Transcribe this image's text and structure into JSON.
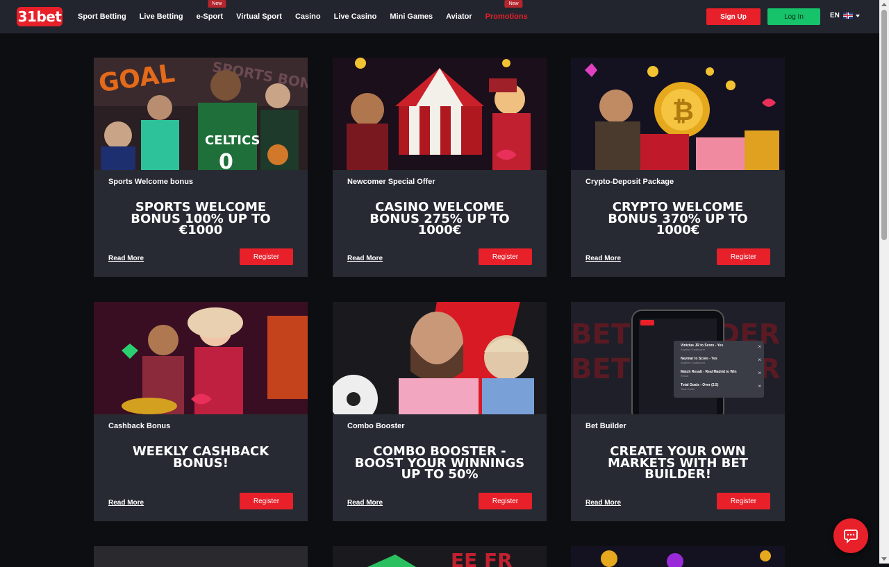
{
  "header": {
    "logo": "31bet",
    "nav": [
      {
        "label": "Sport Betting",
        "badge": ""
      },
      {
        "label": "Live Betting",
        "badge": ""
      },
      {
        "label": "e-Sport",
        "badge": "New"
      },
      {
        "label": "Virtual Sport",
        "badge": ""
      },
      {
        "label": "Casino",
        "badge": ""
      },
      {
        "label": "Live Casino",
        "badge": ""
      },
      {
        "label": "Mini Games",
        "badge": ""
      },
      {
        "label": "Aviator",
        "badge": ""
      },
      {
        "label": "Promotions",
        "badge": "New"
      }
    ],
    "signup_label": "Sign Up",
    "login_label": "Log In",
    "language": "EN"
  },
  "colors": {
    "accent_red": "#e8202a",
    "login_green": "#16c26a",
    "header_bg": "#22252d",
    "card_bg": "#272a33",
    "page_bg": "#0d0e12"
  },
  "promotions": [
    {
      "subtitle": "Sports Welcome bonus",
      "title": "SPORTS WELCOME BONUS 100% UP TO €1000",
      "read_more": "Read More",
      "register": "Register",
      "image": "sports-stars-image"
    },
    {
      "subtitle": "Newcomer Special Offer",
      "title": "CASINO WELCOME BONUS 275% UP TO 1000€",
      "read_more": "Read More",
      "register": "Register",
      "image": "casino-circus-image"
    },
    {
      "subtitle": "Crypto-Deposit Package",
      "title": "CRYPTO WELCOME BONUS 370% UP TO 1000€",
      "read_more": "Read More",
      "register": "Register",
      "image": "crypto-viking-bitcoin-image"
    },
    {
      "subtitle": "Cashback Bonus",
      "title": "WEEKLY CASHBACK BONUS!",
      "read_more": "Read More",
      "register": "Register",
      "image": "genie-characters-image"
    },
    {
      "subtitle": "Combo Booster",
      "title": "COMBO BOOSTER - BOOST YOUR WINNINGS UP TO 50%",
      "read_more": "Read More",
      "register": "Register",
      "image": "football-players-image"
    },
    {
      "subtitle": "Bet Builder",
      "title": "CREATE YOUR OWN MARKETS WITH BET BUILDER!",
      "read_more": "Read More",
      "register": "Register",
      "image": "bet-builder-phone-image"
    }
  ],
  "bet_builder_phone": {
    "brand": "31bet",
    "selections": [
      {
        "text": "Vinicius JR to Score - Yes",
        "sub": "Anytime Goalscorer"
      },
      {
        "text": "Neymar to Score - Yes",
        "sub": "Anytime Goalscorer"
      },
      {
        "text": "Match Result - Real Madrid to Win",
        "sub": "Result"
      },
      {
        "text": "Total Goals - Over (2.5)",
        "sub": "Total Goals"
      }
    ]
  }
}
